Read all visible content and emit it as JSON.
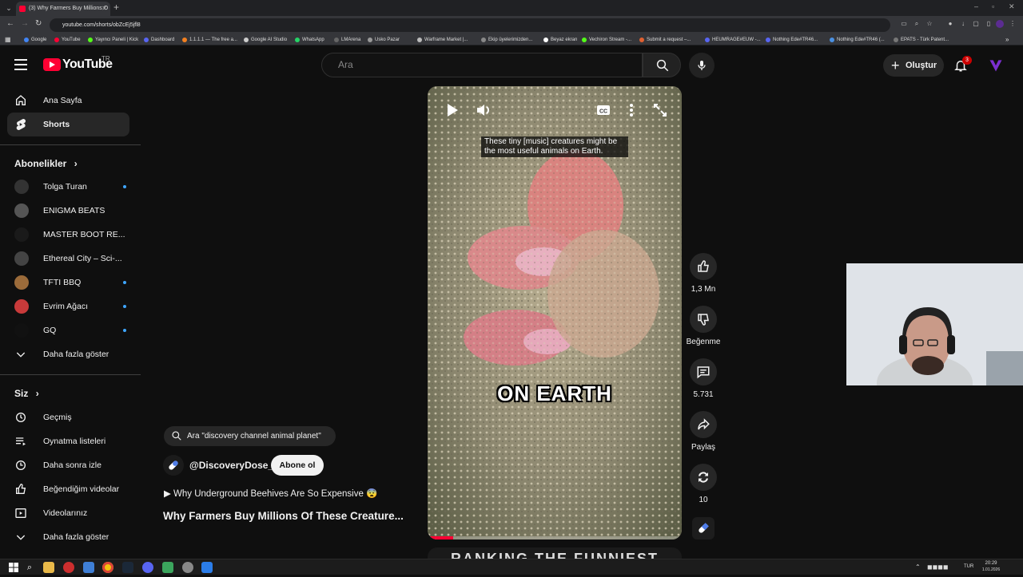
{
  "browser": {
    "tab_title": "(3) Why Farmers Buy Millions O",
    "url": "youtube.com/shorts/obZcEj5jfl8",
    "bookmarks": [
      {
        "label": "Google",
        "color": "#4285f4"
      },
      {
        "label": "YouTube",
        "color": "#ff0033"
      },
      {
        "label": "Yayıncı Paneli | Kick",
        "color": "#53fc18"
      },
      {
        "label": "Dashboard",
        "color": "#5865f2"
      },
      {
        "label": "1.1.1.1 — The free a...",
        "color": "#f38020"
      },
      {
        "label": "Google AI Studio",
        "color": "#cccccc"
      },
      {
        "label": "WhatsApp",
        "color": "#25d366"
      },
      {
        "label": "LMArena",
        "color": "#666666"
      },
      {
        "label": "Usko Pazar",
        "color": "#999999"
      },
      {
        "label": "Warframe Market |...",
        "color": "#bbbbbb"
      },
      {
        "label": "Ekip üyelerimizden...",
        "color": "#888888"
      },
      {
        "label": "Beyaz ekran",
        "color": "#ffffff"
      },
      {
        "label": "Vechiron Stream -...",
        "color": "#53fc18"
      },
      {
        "label": "Submit a request –...",
        "color": "#e06030"
      },
      {
        "label": "HEUMRAGE#EUW -...",
        "color": "#5865f2"
      },
      {
        "label": "Nothing Ede#TR46...",
        "color": "#5865f2"
      },
      {
        "label": "Nothing Ede#TR46 (...",
        "color": "#4a90e2"
      },
      {
        "label": "EPATS - Türk Patent...",
        "color": "#777777"
      }
    ]
  },
  "header": {
    "logo_text": "YouTube",
    "region": "TR",
    "search_placeholder": "Ara",
    "create_label": "Oluştur",
    "notification_count": "3"
  },
  "sidebar": {
    "main": [
      {
        "label": "Ana Sayfa",
        "icon": "home-icon"
      },
      {
        "label": "Shorts",
        "icon": "shorts-icon"
      }
    ],
    "subscriptions_heading": "Abonelikler",
    "subscriptions": [
      {
        "label": "Tolga Turan",
        "dot": true
      },
      {
        "label": "ENIGMA BEATS",
        "dot": false
      },
      {
        "label": "MASTER BOOT RE...",
        "dot": false
      },
      {
        "label": "Ethereal City – Sci-...",
        "dot": false
      },
      {
        "label": "TFTI BBQ",
        "dot": true
      },
      {
        "label": "Evrim Ağacı",
        "dot": true
      },
      {
        "label": "GQ",
        "dot": true
      }
    ],
    "show_more": "Daha fazla göster",
    "you_heading": "Siz",
    "you_items": [
      {
        "label": "Geçmiş",
        "icon": "history-icon"
      },
      {
        "label": "Oynatma listeleri",
        "icon": "playlist-icon"
      },
      {
        "label": "Daha sonra izle",
        "icon": "clock-icon"
      },
      {
        "label": "Beğendiğim videolar",
        "icon": "thumb-up-icon"
      },
      {
        "label": "Videolarınız",
        "icon": "video-icon"
      }
    ],
    "show_more_2": "Daha fazla göster"
  },
  "player": {
    "caption": "These tiny [music] creatures might be the most useful animals on Earth.",
    "overlay_text": "ON EARTH",
    "progress": 0.1,
    "next_peek_text": "RANKING THE FUNNIEST"
  },
  "actions": {
    "likes": "1,3 Mn",
    "dislike": "Beğenme",
    "comments": "5.731",
    "share": "Paylaş",
    "remix": "10"
  },
  "info": {
    "search_chip": "Ara \"discovery channel animal planet\"",
    "channel": "@DiscoveryDose_",
    "subscribe": "Abone ol",
    "playlist": "▶ Why Underground Beehives Are So Expensive 😨",
    "title": "Why Farmers Buy Millions Of These Creature..."
  },
  "taskbar": {
    "lang": "TUR",
    "time": "20:29",
    "date": "1.01.2026"
  }
}
